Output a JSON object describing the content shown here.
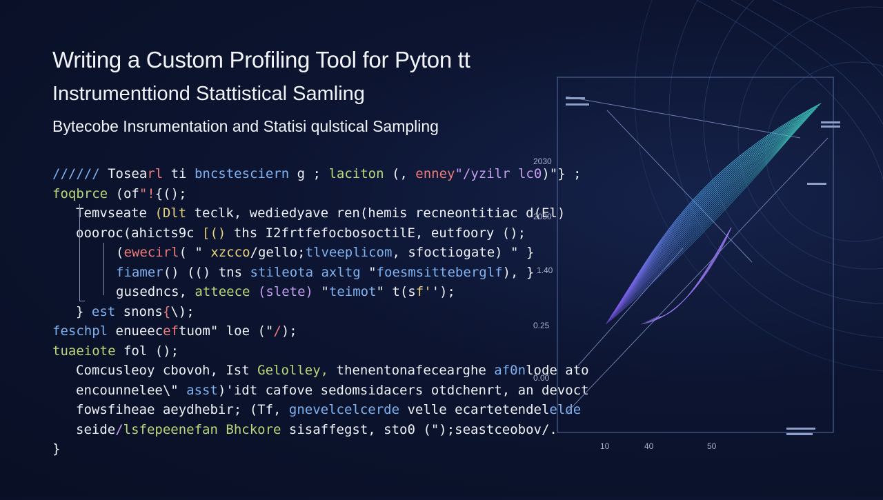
{
  "slide": {
    "title": "Writing a Custom Profiling Tool for Pyton tt",
    "subtitle": "Instrumenttiond Stattistical Samling",
    "tagline": "Bytecobe Insrumentation and Statisi qulstical Sampling"
  },
  "code_lines": [
    {
      "indent": 0,
      "segments": [
        {
          "text": "////// ",
          "color": "blue"
        },
        {
          "text": "Tosea",
          "color": "white"
        },
        {
          "text": "rl ",
          "color": "red"
        },
        {
          "text": "ti ",
          "color": "white"
        },
        {
          "text": "bncstesciern ",
          "color": "blue"
        },
        {
          "text": "g ",
          "color": "white"
        },
        {
          "text": "; ",
          "color": "white"
        },
        {
          "text": "laciton ",
          "color": "green"
        },
        {
          "text": "(, ",
          "color": "white"
        },
        {
          "text": "enney",
          "color": "red"
        },
        {
          "text": "\"/yzilr lc0",
          "color": "purple"
        },
        {
          "text": ")\"} ;",
          "color": "white"
        }
      ]
    },
    {
      "indent": 0,
      "segments": [
        {
          "text": "foqbrce ",
          "color": "green"
        },
        {
          "text": "(of",
          "color": "white"
        },
        {
          "text": "\"!",
          "color": "red"
        },
        {
          "text": "{(",
          "color": "white"
        },
        {
          "text": ");",
          "color": "white"
        }
      ]
    },
    {
      "indent": 1,
      "segments": [
        {
          "text": "Temvseate ",
          "color": "white"
        },
        {
          "text": "(Dlt ",
          "color": "yellow"
        },
        {
          "text": "teclk, ",
          "color": "white"
        },
        {
          "text": "wediedyave ",
          "color": "white"
        },
        {
          "text": "ren(hemis ",
          "color": "white"
        },
        {
          "text": "recneontitiac ",
          "color": "white"
        },
        {
          "text": "d(El)",
          "color": "white"
        }
      ]
    },
    {
      "indent": 1,
      "segments": [
        {
          "text": "oooroc(ahicts",
          "color": "white"
        },
        {
          "text": "9c ",
          "color": "white"
        },
        {
          "text": "[()",
          "color": "yellow"
        },
        {
          "text": " ths ",
          "color": "white"
        },
        {
          "text": "I2frtfefocbosoctilE",
          "color": "white"
        },
        {
          "text": ", ",
          "color": "white"
        },
        {
          "text": "eutfoory ",
          "color": "white"
        },
        {
          "text": "();",
          "color": "white"
        }
      ]
    },
    {
      "indent": 2,
      "segments": [
        {
          "text": "(",
          "color": "white"
        },
        {
          "text": "ewecirl",
          "color": "red"
        },
        {
          "text": "(",
          "color": "white"
        },
        {
          "text": " \" ",
          "color": "white"
        },
        {
          "text": "xzcco",
          "color": "yellow"
        },
        {
          "text": "/gello;",
          "color": "white"
        },
        {
          "text": "tlveeplicom",
          "color": "blue"
        },
        {
          "text": ", ",
          "color": "white"
        },
        {
          "text": "sfoctiogate",
          "color": "white"
        },
        {
          "text": ") \" }",
          "color": "white"
        }
      ]
    },
    {
      "indent": 2,
      "segments": [
        {
          "text": "fiamer",
          "color": "blue"
        },
        {
          "text": "() ",
          "color": "white"
        },
        {
          "text": "(() ",
          "color": "white"
        },
        {
          "text": "tns ",
          "color": "white"
        },
        {
          "text": "stileota ",
          "color": "blue"
        },
        {
          "text": "axltg ",
          "color": "blue"
        },
        {
          "text": "\"",
          "color": "white"
        },
        {
          "text": "foesmsitteberglf",
          "color": "blue"
        },
        {
          "text": "), }",
          "color": "white"
        }
      ]
    },
    {
      "indent": 2,
      "segments": [
        {
          "text": "gusedncs, ",
          "color": "white"
        },
        {
          "text": "atteece ",
          "color": "green"
        },
        {
          "text": "(slete) ",
          "color": "purple"
        },
        {
          "text": "\"",
          "color": "white"
        },
        {
          "text": "teimot",
          "color": "blue"
        },
        {
          "text": "\" ",
          "color": "white"
        },
        {
          "text": "t",
          "color": "white"
        },
        {
          "text": "(s",
          "color": "white"
        },
        {
          "text": "f'",
          "color": "yellow"
        },
        {
          "text": "');",
          "color": "white"
        }
      ]
    },
    {
      "indent": 1,
      "segments": [
        {
          "text": "} ",
          "color": "white"
        },
        {
          "text": "est ",
          "color": "blue"
        },
        {
          "text": "snons",
          "color": "white"
        },
        {
          "text": "{",
          "color": "red"
        },
        {
          "text": "\\);",
          "color": "white"
        }
      ]
    },
    {
      "indent": 0,
      "segments": [
        {
          "text": "feschpl ",
          "color": "blue"
        },
        {
          "text": "enueec",
          "color": "white"
        },
        {
          "text": "ef",
          "color": "red"
        },
        {
          "text": "tuom",
          "color": "white"
        },
        {
          "text": "\" ",
          "color": "white"
        },
        {
          "text": "loe ",
          "color": "white"
        },
        {
          "text": "(\"",
          "color": "white"
        },
        {
          "text": "/",
          "color": "red"
        },
        {
          "text": ");",
          "color": "white"
        }
      ]
    },
    {
      "indent": 0,
      "segments": [
        {
          "text": "tuaeiote ",
          "color": "green"
        },
        {
          "text": "fol ",
          "color": "white"
        },
        {
          "text": "();",
          "color": "white"
        }
      ]
    },
    {
      "indent": 1,
      "segments": [
        {
          "text": "Comcusleoy ",
          "color": "white"
        },
        {
          "text": "cbovoh, ",
          "color": "white"
        },
        {
          "text": "Ist ",
          "color": "white"
        },
        {
          "text": "Gelolley, ",
          "color": "green"
        },
        {
          "text": "thenentonafecearghe ",
          "color": "white"
        },
        {
          "text": "af0n",
          "color": "blue"
        },
        {
          "text": "lode ",
          "color": "white"
        },
        {
          "text": "ato",
          "color": "white"
        }
      ]
    },
    {
      "indent": 1,
      "segments": [
        {
          "text": "encounnelee",
          "color": "white"
        },
        {
          "text": "\\\" ",
          "color": "white"
        },
        {
          "text": "asst",
          "color": "blue"
        },
        {
          "text": ")'idt ",
          "color": "white"
        },
        {
          "text": "cafove ",
          "color": "white"
        },
        {
          "text": "sedomsidacers ",
          "color": "white"
        },
        {
          "text": "otdchenrt, ",
          "color": "white"
        },
        {
          "text": "an ",
          "color": "white"
        },
        {
          "text": "devoct",
          "color": "white"
        }
      ]
    },
    {
      "indent": 1,
      "segments": [
        {
          "text": "fowsfiheae ",
          "color": "white"
        },
        {
          "text": "aeydhebir; ",
          "color": "white"
        },
        {
          "text": "(Tf, ",
          "color": "white"
        },
        {
          "text": "gnevelcelcerde ",
          "color": "blue"
        },
        {
          "text": "velle ",
          "color": "white"
        },
        {
          "text": "ecartetendel",
          "color": "white"
        },
        {
          "text": "elde",
          "color": "blue"
        }
      ]
    },
    {
      "indent": 1,
      "segments": [
        {
          "text": "seide",
          "color": "white"
        },
        {
          "text": "/",
          "color": "purple"
        },
        {
          "text": "lsfepeenefan ",
          "color": "green"
        },
        {
          "text": "Bhckore ",
          "color": "green"
        },
        {
          "text": "sisaffegst, ",
          "color": "white"
        },
        {
          "text": "sto0 ",
          "color": "white"
        },
        {
          "text": "(\");",
          "color": "white"
        },
        {
          "text": "seastceobov",
          "color": "white"
        },
        {
          "text": "/.",
          "color": "white"
        }
      ]
    },
    {
      "indent": 0,
      "segments": [
        {
          "text": "}",
          "color": "white"
        }
      ]
    }
  ],
  "code_colors": {
    "white": "#eef1f8",
    "green": "#b9d87a",
    "blue": "#7fb2f0",
    "red": "#ef7b7b",
    "teal": "#5fd0c6",
    "yellow": "#e8d27a",
    "purple": "#c59ef0",
    "gray": "#b8c0d8"
  },
  "viz": {
    "y_ticks": [
      "2030",
      "2030",
      "1.40",
      "0.25",
      "0.00"
    ],
    "x_ticks": [
      "10",
      "40",
      "50"
    ]
  }
}
